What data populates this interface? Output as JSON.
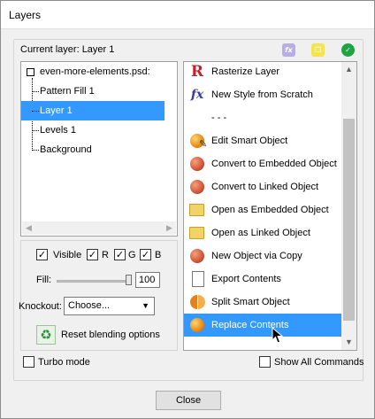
{
  "window": {
    "title": "Layers"
  },
  "current_layer_label": "Current layer: Layer 1",
  "header_icons": [
    "fx-icon",
    "copy-icon",
    "ok-check-icon"
  ],
  "layer_tree": {
    "root": "even-more-elements.psd:",
    "items": [
      "Pattern Fill 1",
      "Layer 1",
      "Levels 1",
      "Background"
    ],
    "selected": "Layer 1"
  },
  "blending": {
    "visible_label": "Visible",
    "r_label": "R",
    "g_label": "G",
    "b_label": "B",
    "visible_checked": true,
    "r_checked": true,
    "g_checked": true,
    "b_checked": true,
    "fill_label": "Fill:",
    "fill_value": "100",
    "knockout_label": "Knockout:",
    "knockout_value": "Choose...",
    "reset_label": "Reset blending options"
  },
  "commands": {
    "items": [
      "Rasterize Layer",
      "New Style from Scratch",
      "- - -",
      "Edit Smart Object",
      "Convert to Embedded Object",
      "Convert to Linked Object",
      "Open as Embedded Object",
      "Open as Linked Object",
      "New Object via Copy",
      "Export Contents",
      "Split Smart Object",
      "Replace Contents"
    ],
    "selected": "Replace Contents"
  },
  "footer": {
    "turbo_label": "Turbo mode",
    "turbo_checked": false,
    "show_all_label": "Show All Commands",
    "show_all_checked": false,
    "close_label": "Close"
  },
  "colors": {
    "selection": "#3399ff",
    "accent_green": "#21a243"
  }
}
